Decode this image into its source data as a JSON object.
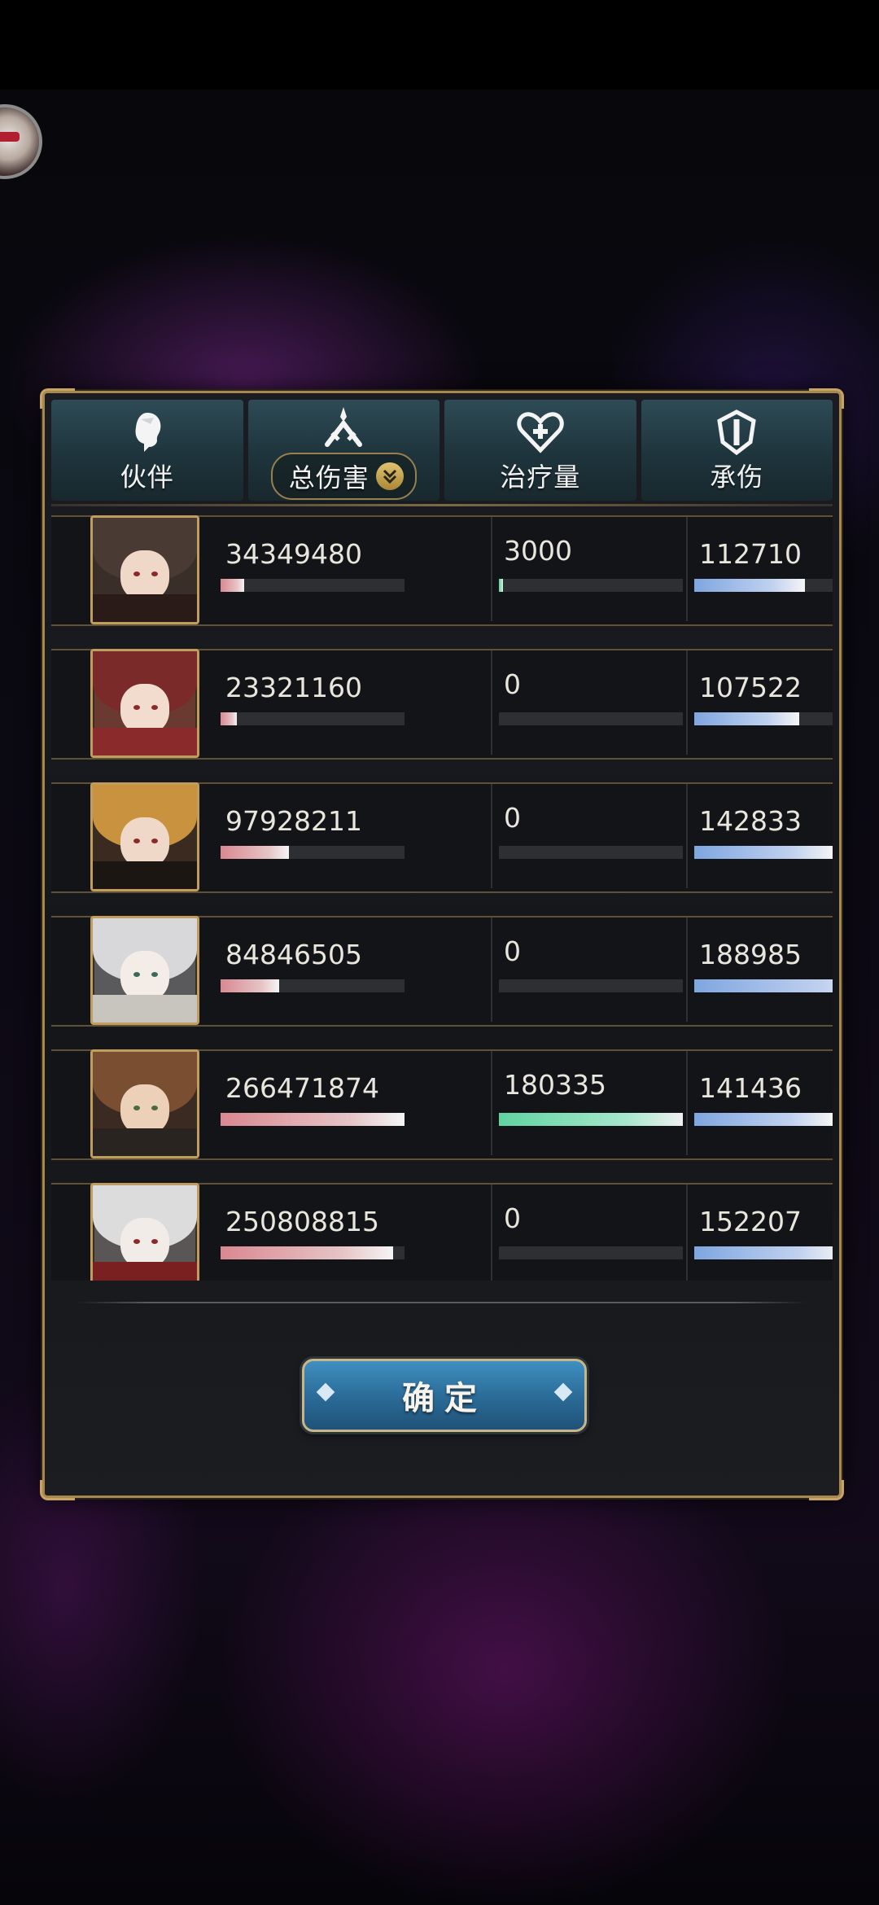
{
  "tabs": [
    {
      "label": "伙伴",
      "icon": "partner-head-icon"
    },
    {
      "label": "总伤害",
      "icon": "crossed-swords-icon",
      "dropdown": true,
      "dropdown_icon": "double-chevron-down-icon"
    },
    {
      "label": "治疗量",
      "icon": "heart-plus-icon"
    },
    {
      "label": "承伤",
      "icon": "shield-icon"
    }
  ],
  "rows": [
    {
      "damage": "34349480",
      "damage_ratio": 0.13,
      "heal": "3000",
      "heal_ratio": 0.02,
      "taken": "112710",
      "taken_ratio": 0.6
    },
    {
      "damage": "23321160",
      "damage_ratio": 0.09,
      "heal": "0",
      "heal_ratio": 0,
      "taken": "107522",
      "taken_ratio": 0.57
    },
    {
      "damage": "97928211",
      "damage_ratio": 0.37,
      "heal": "0",
      "heal_ratio": 0,
      "taken": "142833",
      "taken_ratio": 0.76
    },
    {
      "damage": "84846505",
      "damage_ratio": 0.32,
      "heal": "0",
      "heal_ratio": 0,
      "taken": "188985",
      "taken_ratio": 1.0
    },
    {
      "damage": "266471874",
      "damage_ratio": 1.0,
      "heal": "180335",
      "heal_ratio": 1.0,
      "taken": "141436",
      "taken_ratio": 0.75
    },
    {
      "damage": "250808815",
      "damage_ratio": 0.94,
      "heal": "0",
      "heal_ratio": 0,
      "taken": "152207",
      "taken_ratio": 0.81
    }
  ],
  "confirm_label": "确定",
  "colors": {
    "damage_bar": "#d98891",
    "heal_bar": "#5fd4a0",
    "taken_bar": "#7fa6e0",
    "gold_border": "#a7894f"
  }
}
